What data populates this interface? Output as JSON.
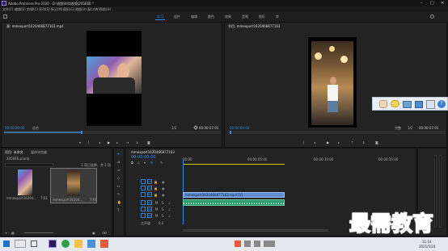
{
  "app": {
    "title": "Adobe Premiere Pro 2020 - D:\\视频\\时尚视频\\245666 *"
  },
  "menu": [
    "文件(F)",
    "编辑(E)",
    "剪辑(C)",
    "序列(S)",
    "标记(M)",
    "图形(G)",
    "视图(V)",
    "窗口(W)",
    "帮助(H)"
  ],
  "workspaces": [
    "学习",
    "组件",
    "编辑",
    "颜色",
    "效果",
    "音频",
    "图形",
    "库"
  ],
  "source": {
    "tab_label": "源: mmexport1620466877163.mp4",
    "timecode": "00:00:00:00",
    "fit": "适合",
    "ratio": "1/2",
    "duration": "00:00:07:01"
  },
  "program": {
    "tab_label": "节目: mmexport1620466877163",
    "timecode": "00:00:00:00",
    "fit": "完整",
    "ratio": "1/2",
    "duration": "00:00:07:01"
  },
  "floating_toolbar": {
    "icons": [
      "hand-icon",
      "chat-icon",
      "folder-icon",
      "save-icon",
      "search-icon",
      "help-icon"
    ]
  },
  "project": {
    "tab_label": "项目: 未命名",
    "tab_label2": "媒体浏览器",
    "path": "245666.prproj",
    "count": "1 项已选择，共 2 项",
    "items": [
      {
        "name": "mmexport16204...",
        "duration": "7:01"
      },
      {
        "name": "mmexport16204...",
        "duration": "7:01"
      }
    ]
  },
  "timeline": {
    "tab_label": "mmexport1620466877163",
    "timecode": "00:00:00:00",
    "ruler": [
      "00:00",
      "00:00:05:00",
      "00:00:10:00",
      "00:00:15:00"
    ],
    "video_tracks": [
      "V3",
      "V2",
      "V1"
    ],
    "audio_tracks": [
      "A1",
      "A2",
      "A3"
    ],
    "master": "主声道",
    "master_value": "0.0",
    "clip_label": "mmexport1620466877163.mp4 [V]"
  },
  "taskbar": {
    "time": "11:14",
    "date": "2021/5/24"
  },
  "watermark": "最需教育"
}
